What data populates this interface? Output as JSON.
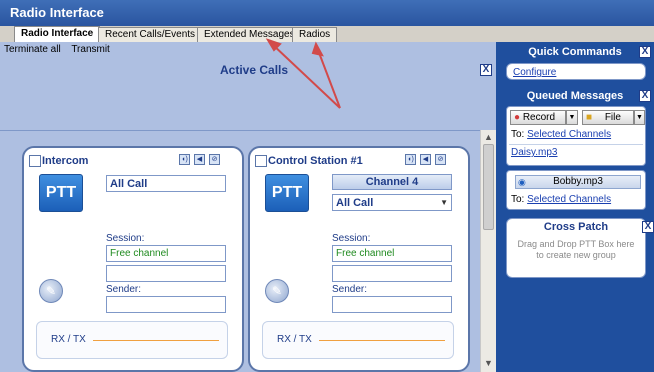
{
  "window": {
    "title": "Radio Interface"
  },
  "tabs": [
    {
      "label": "Radio Interface"
    },
    {
      "label": "Recent Calls/Events"
    },
    {
      "label": "Extended Messages"
    },
    {
      "label": "Radios"
    }
  ],
  "toolbar": {
    "terminate_all": "Terminate all",
    "transmit": "Transmit"
  },
  "main": {
    "active_calls_title": "Active Calls",
    "close_symbol": "X"
  },
  "cards": [
    {
      "title": "Intercom",
      "ptt_label": "PTT",
      "group_value": "All Call",
      "session_label": "Session:",
      "session_value": "Free channel",
      "sender_label": "Sender:",
      "rx_tx_label": "RX / TX"
    },
    {
      "title": "Control Station #1",
      "ptt_label": "PTT",
      "channel": "Channel 4",
      "group_value": "All Call",
      "session_label": "Session:",
      "session_value": "Free channel",
      "sender_label": "Sender:",
      "rx_tx_label": "RX / TX"
    }
  ],
  "quick_commands": {
    "title": "Quick Commands",
    "configure": "Configure"
  },
  "queued_messages": {
    "title": "Queued Messages",
    "record_label": "Record",
    "file_label": "File",
    "to_label": "To:",
    "selected_channels": "Selected Channels",
    "file_name": "Daisy.mp3"
  },
  "playback": {
    "file_name": "Bobby.mp3",
    "to_label": "To:",
    "selected_channels": "Selected Channels"
  },
  "cross_patch": {
    "title": "Cross Patch",
    "hint": "Drag and Drop PTT Box here to create new group"
  },
  "icons": {
    "checkbox": "checkbox-icon",
    "speaker": "speaker-icon",
    "mute": "mute-icon",
    "settings": "settings-icon",
    "microphone": "microphone-icon",
    "record": "record-icon",
    "folder": "folder-icon",
    "play": "play-icon",
    "dropdown": "dropdown-icon"
  },
  "colors": {
    "titlebar": "#2a55a0",
    "panel_bg": "#aebfe1",
    "right_panel": "#1f4f9e",
    "annotation_arrow": "#d24a4a"
  }
}
